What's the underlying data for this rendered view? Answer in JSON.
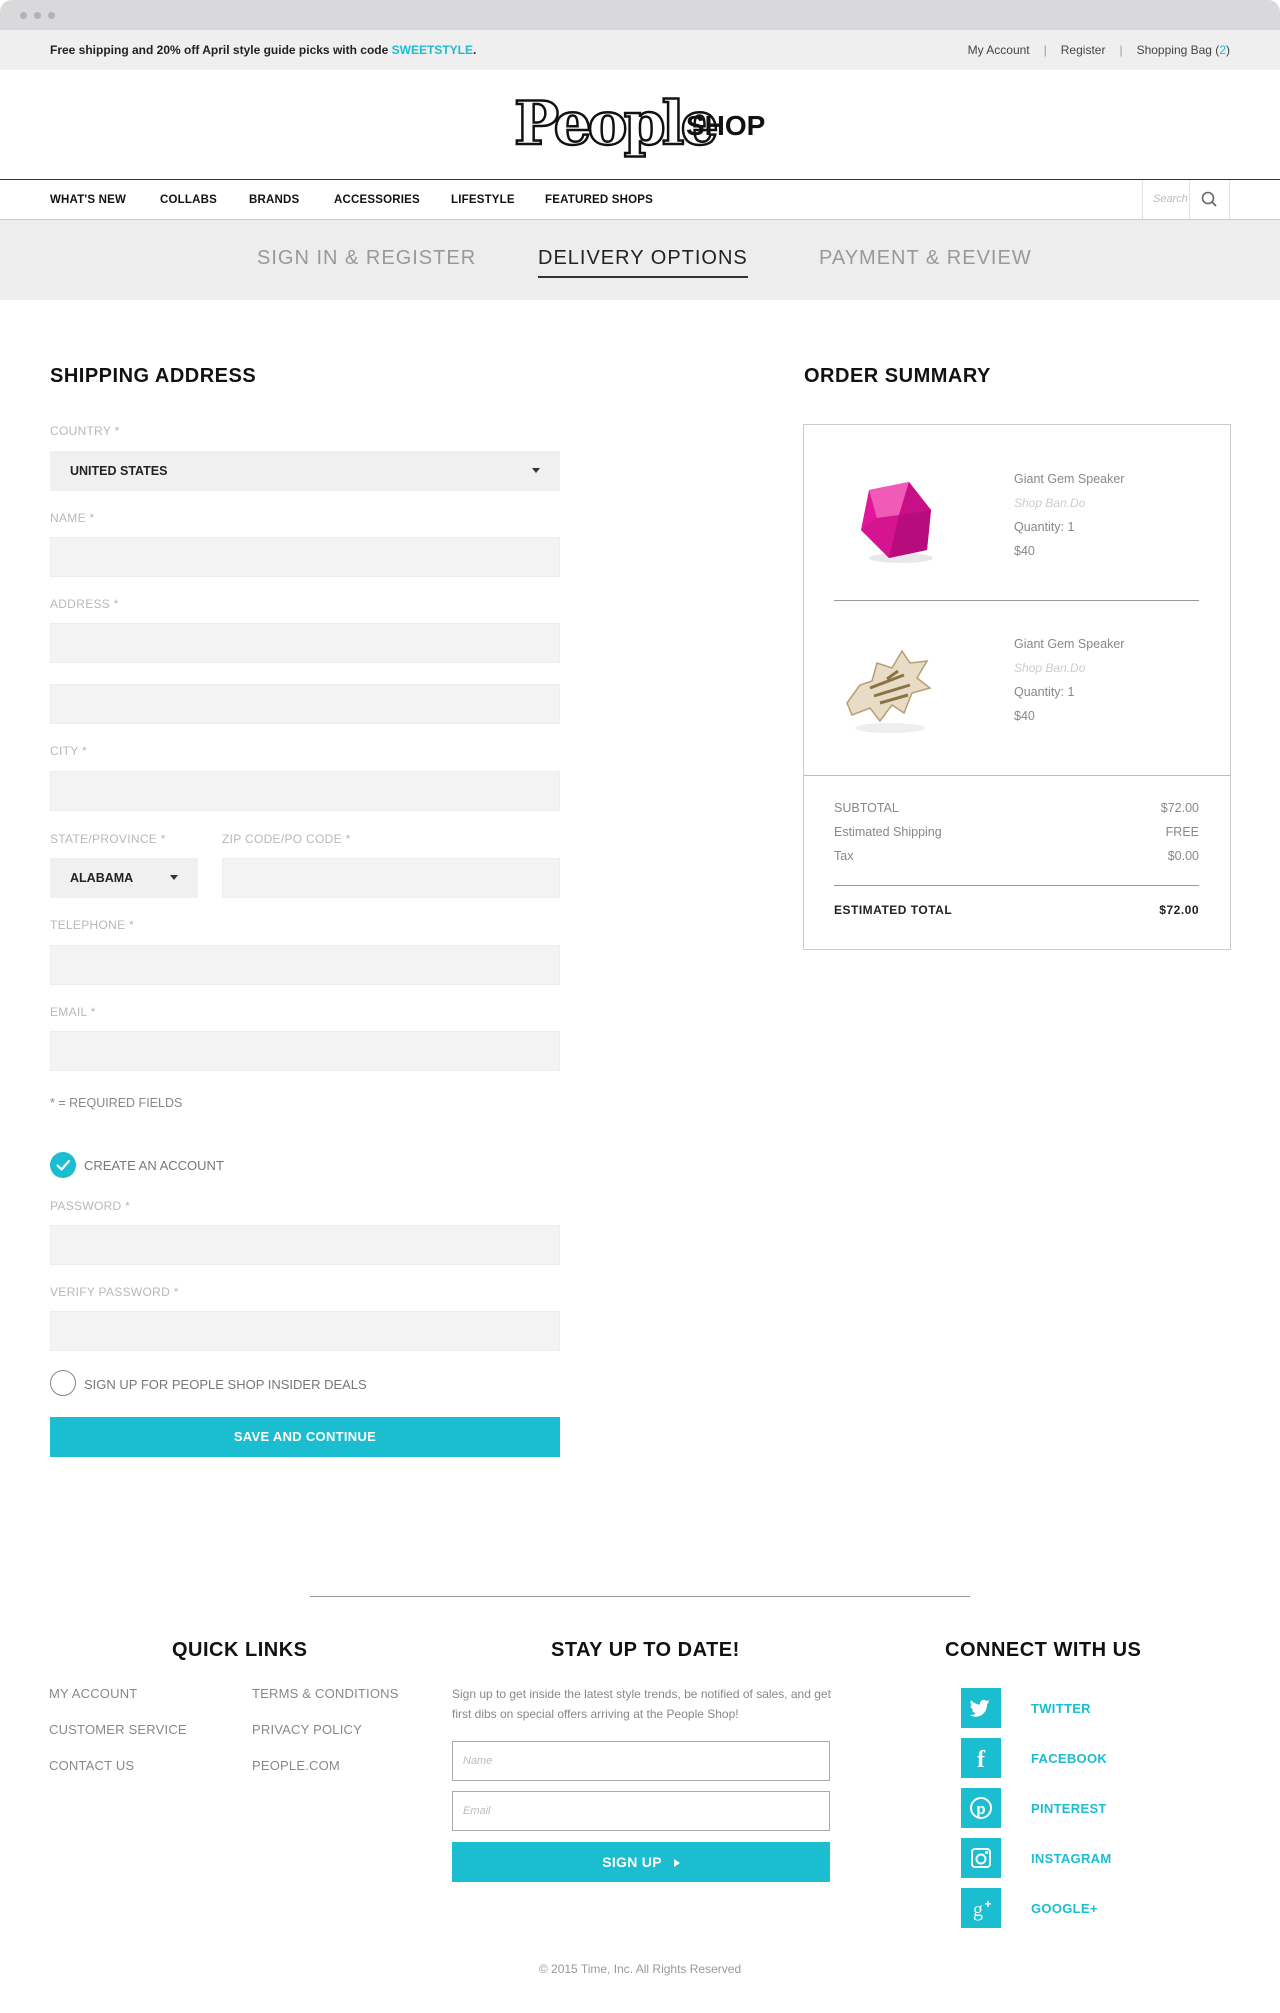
{
  "promo": {
    "message": "Free shipping and 20% off April style guide picks with code ",
    "code": "SWEETSTYLE",
    "end": "."
  },
  "header": {
    "my_account": "My Account",
    "register": "Register",
    "bag_label": "Shopping Bag (",
    "bag_count": "2",
    "bag_close": ")",
    "logo_main": "People",
    "logo_sub": "SHOP"
  },
  "nav": {
    "items": [
      "WHAT'S NEW",
      "COLLABS",
      "BRANDS",
      "ACCESSORIES",
      "LIFESTYLE",
      "FEATURED SHOPS"
    ],
    "search_placeholder": "Search"
  },
  "steps": [
    "SIGN IN & REGISTER",
    "DELIVERY OPTIONS",
    "PAYMENT & REVIEW"
  ],
  "shipping": {
    "title": "SHIPPING ADDRESS",
    "country_label": "COUNTRY *",
    "country_value": "UNITED STATES",
    "name_label": "NAME *",
    "address_label": "ADDRESS *",
    "city_label": "CITY *",
    "state_label": "STATE/PROVINCE *",
    "state_value": "ALABAMA",
    "zip_label": "ZIP CODE/PO CODE *",
    "phone_label": "TELEPHONE *",
    "email_label": "EMAIL *",
    "required_note": "* = REQUIRED FIELDS",
    "create_account": "CREATE AN ACCOUNT",
    "password_label": "PASSWORD *",
    "verify_label": "VERIFY PASSWORD *",
    "insider": "SIGN UP FOR PEOPLE SHOP INSIDER DEALS",
    "save_button": "SAVE AND CONTINUE"
  },
  "summary": {
    "title": "ORDER SUMMARY",
    "items": [
      {
        "name": "Giant Gem Speaker",
        "brand": "Shop Ban.Do",
        "qty": "Quantity: 1",
        "price": "$40"
      },
      {
        "name": "Giant Gem Speaker",
        "brand": "Shop Ban.Do",
        "qty": "Quantity: 1",
        "price": "$40"
      }
    ],
    "subtotal_label": "SUBTOTAL",
    "subtotal": "$72.00",
    "shipping_label": "Estimated Shipping",
    "shipping": "FREE",
    "tax_label": "Tax",
    "tax": "$0.00",
    "total_label": "ESTIMATED TOTAL",
    "total": "$72.00"
  },
  "footer": {
    "quick_links_title": "QUICK LINKS",
    "links_col1": [
      "MY ACCOUNT",
      "CUSTOMER SERVICE",
      "CONTACT US"
    ],
    "links_col2": [
      "TERMS & CONDITIONS",
      "PRIVACY POLICY",
      "PEOPLE.COM"
    ],
    "newsletter_title": "STAY UP TO DATE!",
    "newsletter_text": "Sign up to get inside the latest style trends, be notified of sales, and get first dibs on special offers arriving at the People Shop!",
    "name_placeholder": "Name",
    "email_placeholder": "Email",
    "signup_button": "SIGN UP",
    "connect_title": "CONNECT WITH US",
    "social": [
      "TWITTER",
      "FACEBOOK",
      "PINTEREST",
      "INSTAGRAM",
      "GOOGLE+"
    ],
    "copyright": "© 2015 Time, Inc. All Rights Reserved"
  },
  "colors": {
    "accent": "#1bbdd0",
    "gem": "#e0179a"
  }
}
